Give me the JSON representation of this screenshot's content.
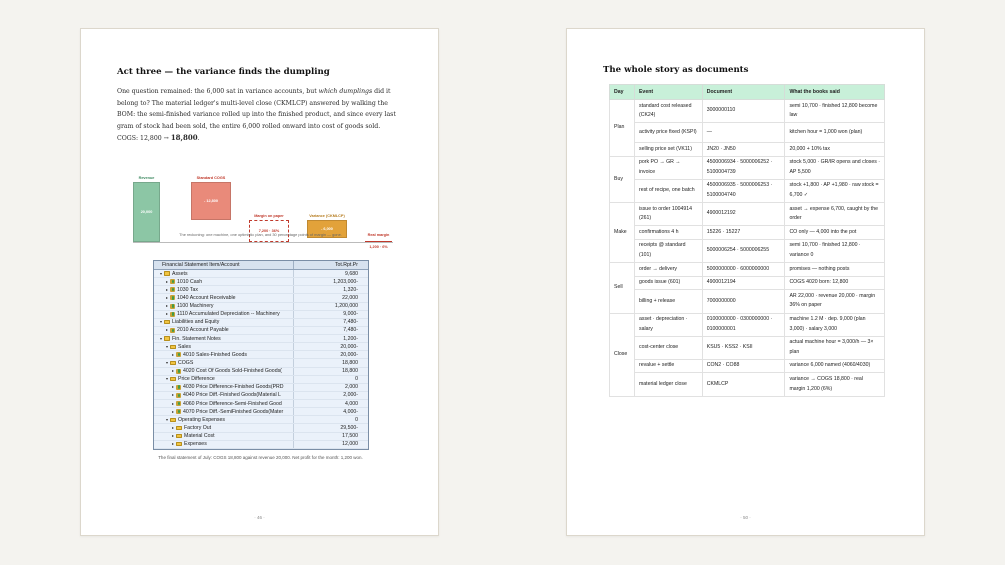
{
  "left_page": {
    "heading": "Act three — the variance finds the dumpling",
    "paragraph": {
      "p1": "One question remained: the 6,000 sat in variance accounts, but ",
      "p1_italic": "which dumplings",
      "p2": " did it belong to? The material ledger's multi-level close (CKMLCP) answered by walking the BOM: the semi-finished variance rolled up into the finished product, and since every last gram of stock had been sold, the entire 6,000 rolled onward into cost of goods sold. COGS: 12,800 → ",
      "p2_bold": "18,800",
      "p3": "."
    },
    "waterfall": {
      "caption": "The reckoning: one machine, one optimistic plan, and 30 percentage points of margin — gone.",
      "bars": [
        {
          "label": "Revenue",
          "value_text": "20,000",
          "value": 20000,
          "color": "#8cc6a5"
        },
        {
          "label": "Standard COGS",
          "value_text": "- 12,800",
          "value": -12800,
          "color": "#e98a7a"
        },
        {
          "label": "Margin on paper",
          "value_text": "7,200 · 36%",
          "value": 7200,
          "color": "#c0392b"
        },
        {
          "label": "Variance (CKMLCP)",
          "value_text": "- 6,000",
          "value": -6000,
          "color": "#e2a23a"
        },
        {
          "label": "Real margin",
          "value_text": "1,200 · 6%",
          "value": 1200,
          "color": "#c0392b"
        }
      ]
    },
    "sap": {
      "col1": "Financial Statement Item/Account",
      "col2": "Tot.Rpt.Pr",
      "caption": "The final statement of July: COGS 18,800 against revenue 20,000. Net profit for the month: 1,200 won.",
      "rows": [
        {
          "level": 0,
          "type": "folder",
          "open": true,
          "label": "Assets",
          "value": "9,680"
        },
        {
          "level": 1,
          "type": "leaf",
          "open": false,
          "label": "1010 Cash",
          "value": "1,203,000-"
        },
        {
          "level": 1,
          "type": "leaf",
          "open": false,
          "label": "1030 Tax",
          "value": "1,320-"
        },
        {
          "level": 1,
          "type": "leaf",
          "open": false,
          "label": "1040 Account Receivable",
          "value": "22,000"
        },
        {
          "level": 1,
          "type": "leaf",
          "open": false,
          "label": "1100 Machinery",
          "value": "1,200,000"
        },
        {
          "level": 1,
          "type": "leaf",
          "open": false,
          "label": "1110 Accumulated Depreciation -- Machinery",
          "value": "9,000-"
        },
        {
          "level": 0,
          "type": "folder",
          "open": true,
          "label": "Liabilities and Equity",
          "value": "7,480-"
        },
        {
          "level": 1,
          "type": "leaf",
          "open": false,
          "label": "2010 Account Payable",
          "value": "7,480-"
        },
        {
          "level": 0,
          "type": "folder",
          "open": true,
          "label": "Fin. Statement Notes",
          "value": "1,200-"
        },
        {
          "level": 1,
          "type": "folder",
          "open": true,
          "label": "Sales",
          "value": "20,000-"
        },
        {
          "level": 2,
          "type": "leaf",
          "open": false,
          "label": "4010 Sales-Finished Goods",
          "value": "20,000-"
        },
        {
          "level": 1,
          "type": "folder",
          "open": true,
          "label": "COGS",
          "value": "18,800"
        },
        {
          "level": 2,
          "type": "leaf",
          "open": false,
          "label": "4020 Cost Of Goods Sold-Finished Goods(",
          "value": "18,800"
        },
        {
          "level": 1,
          "type": "folder",
          "open": true,
          "label": "Price Difference",
          "value": "0"
        },
        {
          "level": 2,
          "type": "leaf",
          "open": false,
          "label": "4030 Price Difference-Finished Goods(PRD",
          "value": "2,000"
        },
        {
          "level": 2,
          "type": "leaf",
          "open": false,
          "label": "4040 Price Diff.-Finished Goods(Material L",
          "value": "2,000-"
        },
        {
          "level": 2,
          "type": "leaf",
          "open": false,
          "label": "4060 Price Difference-Semi-Finished Good",
          "value": "4,000"
        },
        {
          "level": 2,
          "type": "leaf",
          "open": false,
          "label": "4070 Price Diff.-SemiFinished Goods(Mater",
          "value": "4,000-"
        },
        {
          "level": 1,
          "type": "folder",
          "open": true,
          "label": "Operating Expenses",
          "value": "0"
        },
        {
          "level": 2,
          "type": "folder",
          "open": false,
          "label": "Factory Out",
          "value": "29,500-"
        },
        {
          "level": 2,
          "type": "folder",
          "open": false,
          "label": "Material Cost",
          "value": "17,500"
        },
        {
          "level": 2,
          "type": "folder",
          "open": false,
          "label": "Expenses",
          "value": "12,000"
        }
      ]
    },
    "page_number": "· 46 ·"
  },
  "right_page": {
    "heading": "The whole story as documents",
    "columns": [
      "Day",
      "Event",
      "Document",
      "What the books said"
    ],
    "groups": [
      {
        "day": "Plan",
        "rows": [
          {
            "event": "standard cost released (CK24)",
            "document": "3000000110",
            "said": "semi 10,700 · finished 12,800 become law"
          },
          {
            "event": "activity price fixed (KSPI)",
            "document": "—",
            "said": "kitchen hour = 1,000 won (plan)"
          },
          {
            "event": "selling price set (VK11)",
            "document": "JN20 · JN50",
            "said": "20,000 + 10% tax"
          }
        ]
      },
      {
        "day": "Buy",
        "rows": [
          {
            "event": "pork PO → GR → invoice",
            "document": "4500006934 · 5000006252 · 5100004739",
            "said": "stock 5,000 · GR/IR opens and closes · AP 5,500"
          },
          {
            "event": "rest of recipe, one batch",
            "document": "4500006935 · 5000006253 · 5100004740",
            "said": "stock +1,800 · AP +1,980 · raw stock = 6,700 ✓"
          }
        ]
      },
      {
        "day": "Make",
        "rows": [
          {
            "event": "issue to order 1004914 (261)",
            "document": "4900012192",
            "said": "asset → expense 6,700, caught by the order"
          },
          {
            "event": "confirmations 4 h",
            "document": "15226 · 15227",
            "said": "CO only — 4,000 into the pot"
          },
          {
            "event": "receipts @ standard (101)",
            "document": "5000006254 · 5000006255",
            "said": "semi 10,700 · finished 12,800 · variance 0"
          }
        ]
      },
      {
        "day": "Sell",
        "rows": [
          {
            "event": "order → delivery",
            "document": "5000000000 · 6000000000",
            "said": "promises — nothing posts"
          },
          {
            "event": "goods issue (601)",
            "document": "4900012194",
            "said": "COGS 4020 born: 12,800"
          },
          {
            "event": "billing + release",
            "document": "7000000000",
            "said": "AR 22,000 · revenue 20,000 · margin 36% on paper"
          }
        ]
      },
      {
        "day": "Close",
        "rows": [
          {
            "event": "asset · depreciation · salary",
            "document": "0100000000 · 0300000000 · 0100000001",
            "said": "machine 1.2 M · dep. 9,000 (plan 3,000) · salary 3,000"
          },
          {
            "event": "cost-center close",
            "document": "KSU5 · KSS2 · KSII",
            "said": "actual machine hour = 3,000/h — 3× plan"
          },
          {
            "event": "revalue + settle",
            "document": "CON2 · CO88",
            "said": "variance 6,000 named (4060/4030)"
          },
          {
            "event": "material ledger close",
            "document": "CKMLCP",
            "said": "variance → COGS 18,800 · real margin 1,200 (6%)"
          }
        ]
      }
    ],
    "page_number": "· 50 ·"
  }
}
